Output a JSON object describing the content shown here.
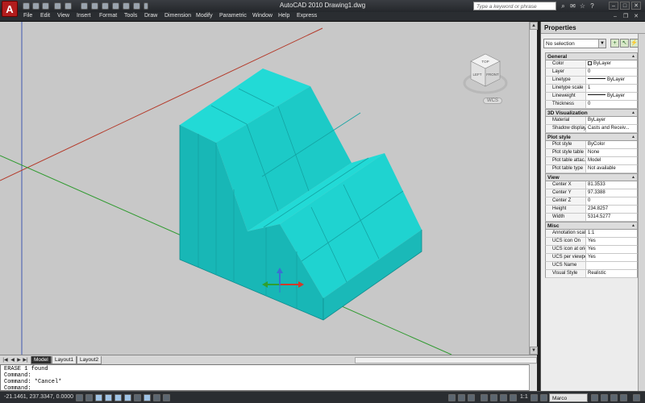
{
  "title_bar": {
    "window_title": "AutoCAD 2010    Drawing1.dwg",
    "search_placeholder": "Type a keyword or phrase",
    "app_letter": "A"
  },
  "menu": {
    "items": [
      "File",
      "Edit",
      "View",
      "Insert",
      "Format",
      "Tools",
      "Draw",
      "Dimension",
      "Modify",
      "Parametric",
      "Window",
      "Help",
      "Express"
    ]
  },
  "viewcube": {
    "top_label": "TOP",
    "left_label": "LEFT",
    "front_label": "FRONT",
    "wcs_label": "WCS"
  },
  "layout_tabs": [
    "Model",
    "Layout1",
    "Layout2"
  ],
  "command_line": {
    "lines": [
      "ERASE 1 found",
      "Command:",
      "Command: *Cancel*",
      "Command:"
    ]
  },
  "status_bar": {
    "coordinates": "-21.1461, 237.3347, 0.0000",
    "scale": "1:1",
    "workspace": "Marco Morandi"
  },
  "properties": {
    "title": "Properties",
    "selection": "No selection",
    "sections": [
      {
        "name": "General",
        "rows": [
          {
            "name": "Color",
            "value": "ByLayer"
          },
          {
            "name": "Layer",
            "value": "0"
          },
          {
            "name": "Linetype",
            "value": "ByLayer"
          },
          {
            "name": "Linetype scale",
            "value": "1"
          },
          {
            "name": "Lineweight",
            "value": "ByLayer"
          },
          {
            "name": "Thickness",
            "value": "0"
          }
        ]
      },
      {
        "name": "3D Visualization",
        "rows": [
          {
            "name": "Material",
            "value": "ByLayer"
          },
          {
            "name": "Shadow display",
            "value": "Casts and Receiv..."
          }
        ]
      },
      {
        "name": "Plot style",
        "rows": [
          {
            "name": "Plot style",
            "value": "ByColor"
          },
          {
            "name": "Plot style table",
            "value": "None"
          },
          {
            "name": "Plot table attac...",
            "value": "Model"
          },
          {
            "name": "Plot table type",
            "value": "Not available"
          }
        ]
      },
      {
        "name": "View",
        "rows": [
          {
            "name": "Center X",
            "value": "81.3533"
          },
          {
            "name": "Center Y",
            "value": "97.3388"
          },
          {
            "name": "Center Z",
            "value": "0"
          },
          {
            "name": "Height",
            "value": "234.8257"
          },
          {
            "name": "Width",
            "value": "5314.5277"
          }
        ]
      },
      {
        "name": "Misc",
        "rows": [
          {
            "name": "Annotation scale",
            "value": "1:1"
          },
          {
            "name": "UCS icon On",
            "value": "Yes"
          },
          {
            "name": "UCS icon at origin",
            "value": "Yes"
          },
          {
            "name": "UCS per viewport",
            "value": "Yes"
          },
          {
            "name": "UCS Name",
            "value": ""
          },
          {
            "name": "Visual Style",
            "value": "Realistic"
          }
        ]
      }
    ]
  },
  "colors": {
    "solid_top": "#22dad6",
    "solid_front": "#1cc4c2",
    "solid_side": "#17aeb0",
    "viewport_bg": "#c8c8c8",
    "axis_x": "#b43a2a",
    "axis_y": "#2f9a2f",
    "axis_z": "#4058b0"
  }
}
